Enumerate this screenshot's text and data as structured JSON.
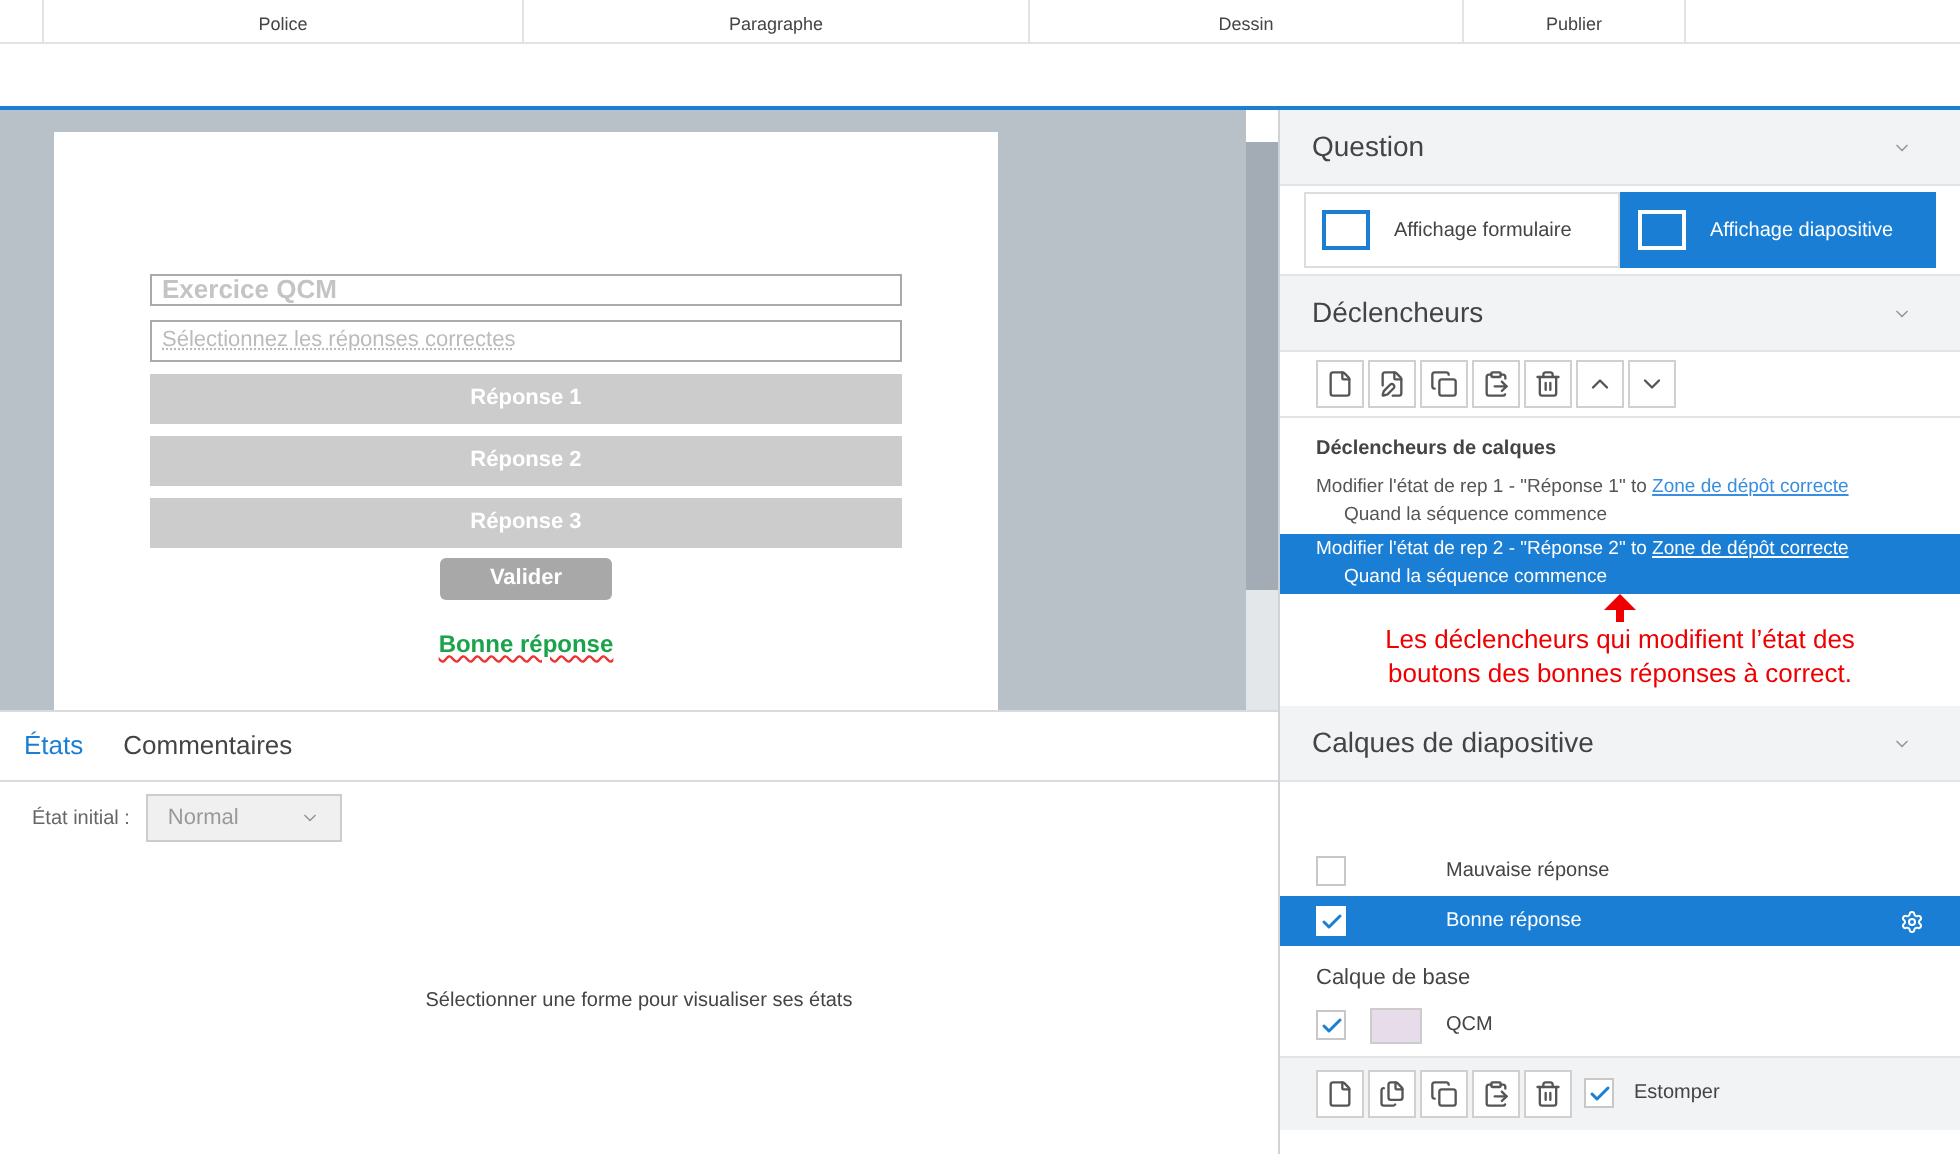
{
  "ribbon_groups": [
    "Police",
    "Paragraphe",
    "Dessin",
    "Publier"
  ],
  "slide": {
    "title": "Exercice QCM",
    "instruction": "Sélectionnez les réponses correctes",
    "answers": [
      "Réponse 1",
      "Réponse 2",
      "Réponse 3"
    ],
    "submit": "Valider",
    "feedback": "Bonne réponse"
  },
  "bottom_tabs": [
    {
      "label": "États",
      "selected": true
    },
    {
      "label": "Commentaires",
      "selected": false
    }
  ],
  "initial_state": {
    "label": "État initial :",
    "value": "Normal"
  },
  "empty_message": "Sélectionner une forme pour visualiser ses états",
  "question": {
    "title": "Question",
    "views": [
      {
        "label": "Affichage formulaire",
        "selected": false
      },
      {
        "label": "Affichage diapositive",
        "selected": true
      }
    ]
  },
  "triggers": {
    "title": "Déclencheurs",
    "group": "Déclencheurs de calques",
    "items": [
      {
        "action": "Modifier l'état de rep 1 - \"Réponse 1\" to",
        "link": "Zone de dépôt correcte",
        "condition": "Quand la séquence commence",
        "selected": false
      },
      {
        "action": "Modifier l'état de rep 2 - \"Réponse 2\" to",
        "link": "Zone de dépôt correcte",
        "condition": "Quand la séquence commence",
        "selected": true
      }
    ]
  },
  "annotation": "Les déclencheurs qui modifient l’état des boutons des bonnes réponses à correct.",
  "layers": {
    "title": "Calques de diapositive",
    "items": [
      {
        "name": "Mauvaise réponse",
        "checked": false,
        "selected": false
      },
      {
        "name": "Bonne réponse",
        "checked": true,
        "selected": true
      }
    ],
    "base_title": "Calque de base",
    "base": {
      "name": "QCM",
      "checked": true
    },
    "dim": {
      "label": "Estomper",
      "checked": true
    }
  }
}
